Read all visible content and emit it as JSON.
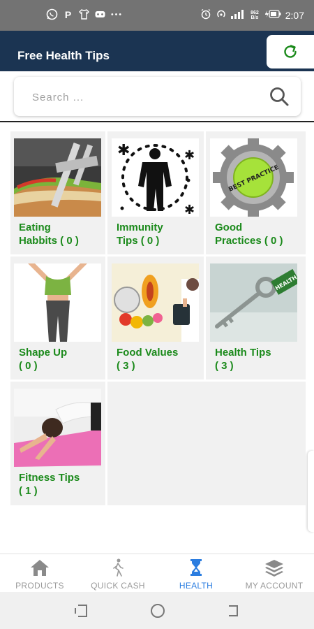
{
  "status_bar": {
    "left_icons": [
      "whatsapp-icon",
      "p-app-icon",
      "shirt-icon",
      "gamepad-icon",
      "more-dots-icon"
    ],
    "net_speed_top": "862",
    "net_speed_bottom": "B/s",
    "time": "2:07"
  },
  "header": {
    "title": "Free Health Tips"
  },
  "search": {
    "placeholder": "Search ..."
  },
  "categories": [
    {
      "line1": "Eating",
      "line2": "Habbits ( 0 )"
    },
    {
      "line1": "Immunity",
      "line2": "Tips ( 0 )"
    },
    {
      "line1": "Good",
      "line2": "Practices ( 0 )"
    },
    {
      "line1": "Shape Up",
      "line2": "( 0 )"
    },
    {
      "line1": "Food Values",
      "line2": "( 3 )"
    },
    {
      "line1": "Health Tips",
      "line2": "( 3 )"
    },
    {
      "line1": "Fitness Tips",
      "line2": "( 1 )"
    }
  ],
  "image_text": {
    "badge": "BEST PRACTICE",
    "tag": "HEALTH"
  },
  "bottom_nav": [
    {
      "label": "PRODUCTS",
      "icon": "home-icon",
      "active": false
    },
    {
      "label": "QUICK CASH",
      "icon": "walking-person-icon",
      "active": false
    },
    {
      "label": "HEALTH",
      "icon": "hourglass-icon",
      "active": true
    },
    {
      "label": "MY ACCOUNT",
      "icon": "layers-icon",
      "active": false
    }
  ],
  "colors": {
    "header_bg": "#1b3452",
    "category_text": "#1b8a1b",
    "active_nav": "#2b7de0",
    "inactive_nav": "#9a9a9a"
  }
}
